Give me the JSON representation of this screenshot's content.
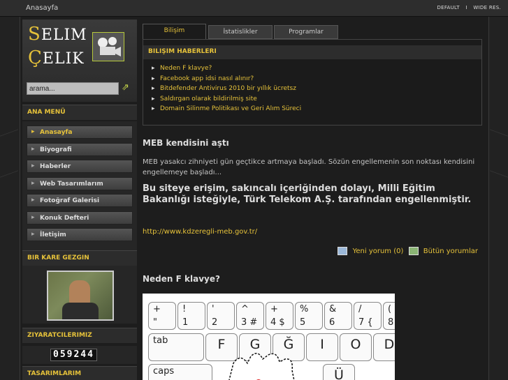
{
  "topbar": {
    "breadcrumb": "Anasayfa",
    "link_default": "DEFAULT",
    "sep": "I",
    "link_wide": "WIDE RES."
  },
  "logo": {
    "line1_first": "S",
    "line1_rest": "ELIM",
    "line2_first": "Ç",
    "line2_rest": "ELIK"
  },
  "search": {
    "value": "arama..."
  },
  "menu": {
    "heading": "ANA MENÜ",
    "items": [
      {
        "label": "Anasayfa",
        "active": true
      },
      {
        "label": "Biyografi"
      },
      {
        "label": "Haberler"
      },
      {
        "label": "Web Tasarımlarım"
      },
      {
        "label": "Fotoğraf Galerisi"
      },
      {
        "label": "Konuk Defteri"
      },
      {
        "label": "İletişim"
      }
    ]
  },
  "photo": {
    "heading": "BIR KARE GEZGIN"
  },
  "visitors": {
    "heading": "ZIYARATCILERIMIZ",
    "count": "059244"
  },
  "designs": {
    "heading": "TASARIMLARIM"
  },
  "tabs": [
    "Bilişim",
    "İstatislikler",
    "Programlar"
  ],
  "news": {
    "heading": "BILIŞIM HABERLERI",
    "items": [
      "Neden F klavye?",
      "Facebook app idsi nasıl alınır?",
      "Bitdefender Antivirus 2010 bir yıllık ücretsz",
      "Saldırgan olarak bildirilmiş site",
      "Domain Silinme Politikası ve Geri Alım Süreci"
    ]
  },
  "post1": {
    "title": "MEB kendisini aştı",
    "body": "MEB yasakcı zihniyeti gün geçtikce artmaya başladı. Sözün engellemenin son noktası kendisini engellemeye başladı...",
    "bold": "Bu siteye erişim, sakıncalı içeriğinden dolayı, Milli Eğitim Bakanlığı isteğiyle, Türk Telekom A.Ş. tarafından engellenmiştir.",
    "link": "http://www.kdzeregli-meb.gov.tr/",
    "new_comment": "Yeni yorum (0)",
    "all_comments": "Bütün yorumlar"
  },
  "post2": {
    "title": "Neden F klavye?"
  },
  "keyboard": {
    "row1": [
      [
        "+",
        "\""
      ],
      [
        "!",
        "1"
      ],
      [
        "'",
        "2"
      ],
      [
        "^",
        "3 #"
      ],
      [
        "+",
        "4 $"
      ],
      [
        "%",
        "5"
      ],
      [
        "&",
        "6"
      ],
      [
        "/",
        "7 {"
      ],
      [
        "(",
        "8"
      ]
    ],
    "tab": "tab",
    "row2": [
      "F",
      "G",
      "Ğ",
      "I",
      "O",
      "D"
    ],
    "caps": "caps",
    "row3_last": "Ü"
  },
  "colors": {
    "accent": "#e6c23a",
    "background": "#1d1d1d"
  }
}
